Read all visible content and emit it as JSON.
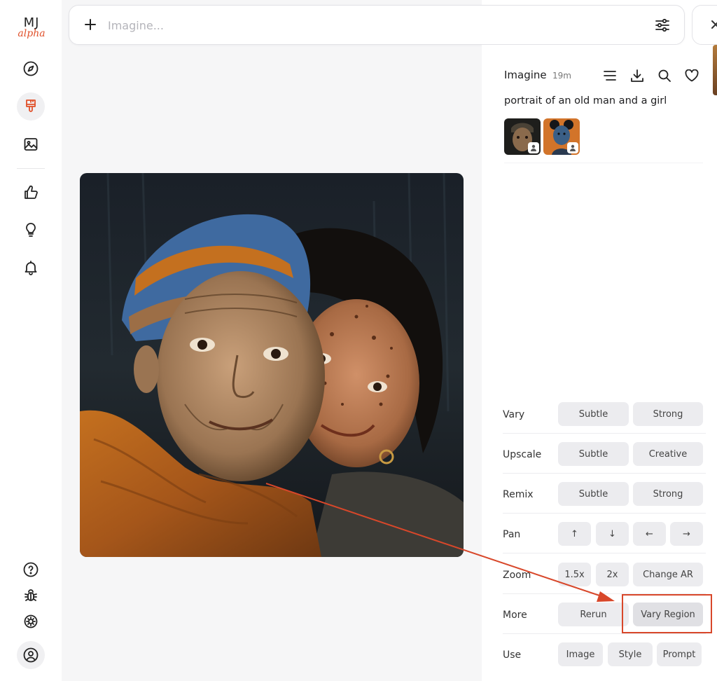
{
  "logo": {
    "primary": "MJ",
    "secondary": "alpha"
  },
  "sidebar": {
    "items": [
      {
        "name": "explore",
        "icon": "compass-icon"
      },
      {
        "name": "create",
        "icon": "paintbrush-icon",
        "active": true
      },
      {
        "name": "organize",
        "icon": "image-icon"
      },
      {
        "name": "rate",
        "icon": "thumbs-up-icon"
      },
      {
        "name": "tasks",
        "icon": "lightbulb-icon"
      },
      {
        "name": "notifications",
        "icon": "bell-icon"
      }
    ],
    "bottom": [
      {
        "name": "help",
        "icon": "help-circle-icon"
      },
      {
        "name": "report-bug",
        "icon": "bug-icon"
      },
      {
        "name": "theme",
        "icon": "sun-icon"
      },
      {
        "name": "account",
        "icon": "user-circle-icon"
      }
    ]
  },
  "search": {
    "placeholder": "Imagine..."
  },
  "panel": {
    "title": "Imagine",
    "time": "19m",
    "prompt": "portrait of an old man and a girl"
  },
  "actions": {
    "vary": {
      "label": "Vary",
      "buttons": [
        "Subtle",
        "Strong"
      ]
    },
    "upscale": {
      "label": "Upscale",
      "buttons": [
        "Subtle",
        "Creative"
      ]
    },
    "remix": {
      "label": "Remix",
      "buttons": [
        "Subtle",
        "Strong"
      ]
    },
    "pan": {
      "label": "Pan",
      "buttons": [
        "↑",
        "↓",
        "←",
        "→"
      ]
    },
    "zoom": {
      "label": "Zoom",
      "buttons": [
        "1.5x",
        "2x",
        "Change AR"
      ]
    },
    "more": {
      "label": "More",
      "buttons": [
        "Rerun",
        "Vary Region"
      ]
    },
    "use": {
      "label": "Use",
      "buttons": [
        "Image",
        "Style",
        "Prompt"
      ]
    }
  },
  "colors": {
    "accent": "#e0502a",
    "annotation": "#d8472a",
    "button_bg": "#ececef"
  }
}
